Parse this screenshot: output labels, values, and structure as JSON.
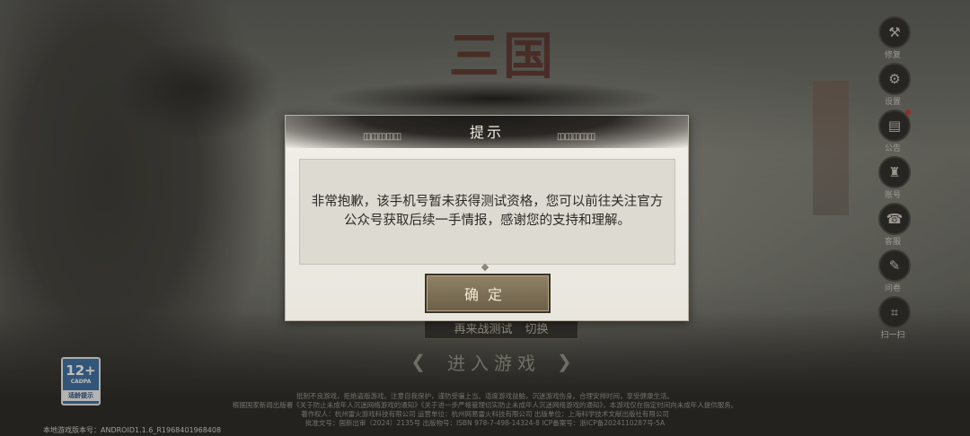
{
  "game": {
    "logo_text": "三国"
  },
  "sidebar": [
    {
      "icon": "tools-icon",
      "glyph": "⚒",
      "label": "修复"
    },
    {
      "icon": "settings-icon",
      "glyph": "⚙",
      "label": "设置"
    },
    {
      "icon": "notice-icon",
      "glyph": "▤",
      "label": "公告",
      "badge": true
    },
    {
      "icon": "account-icon",
      "glyph": "♜",
      "label": "账号"
    },
    {
      "icon": "service-icon",
      "glyph": "☎",
      "label": "客服"
    },
    {
      "icon": "survey-icon",
      "glyph": "✎",
      "label": "问卷"
    },
    {
      "icon": "scan-icon",
      "glyph": "⌗",
      "label": "扫一扫"
    }
  ],
  "background_buttons": {
    "test_label": "再来战测试",
    "switch_label": "切换",
    "enter_label": "进入游戏"
  },
  "age_rating": {
    "age": "12+",
    "caption": "适龄提示",
    "org": "CADPA"
  },
  "legal": {
    "line1": "抵制不良游戏，拒绝盗版游戏。注意自我保护，谨防受骗上当。适度游戏益脑，沉迷游戏伤身。合理安排时间，享受健康生活。",
    "line2": "根据国家新闻出版署《关于防止未成年人沉迷网络游戏的通知》《关于进一步严格管理切实防止未成年人沉迷网络游戏的通知》，本游戏仅在指定时间向未成年人提供服务。",
    "line3": "著作权人：杭州雷火游戏科技有限公司  运营单位：杭州网易雷火科技有限公司  出版单位：上海科学技术文献出版社有限公司",
    "line4": "批准文号：国新出审〔2024〕2135号  出版物号：ISBN 978-7-498-14324-8  ICP备案号：浙ICP备2024110287号-5A"
  },
  "version": {
    "label": "本地游戏版本号：",
    "value": "ANDROID1.1.6_R1968401968408"
  },
  "dialog": {
    "title": "提示",
    "message": "非常抱歉，该手机号暂未获得测试资格，您可以前往关注官方公众号获取后续一手情报，感谢您的支持和理解。",
    "confirm_label": "确定"
  },
  "colors": {
    "dialog_bg": "#f1efe9",
    "button_brown": "#7c6f55",
    "header_dark": "#1c1a18"
  }
}
